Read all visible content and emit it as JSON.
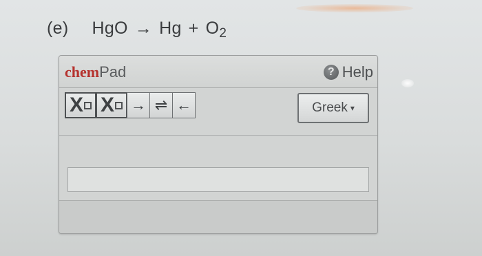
{
  "problem": {
    "label": "(e)",
    "reactant": "HgO",
    "arrow": "→",
    "product1": "Hg",
    "plus": "+",
    "product2_element": "O",
    "product2_subscript": "2"
  },
  "chempad": {
    "brand_chem": "chem",
    "brand_pad": "Pad",
    "help_icon_glyph": "?",
    "help_label": "Help",
    "toolbar": {
      "subscript_label": "X",
      "superscript_label": "X",
      "right_arrow": "→",
      "equilibrium_arrow": "⇌",
      "left_arrow": "←"
    },
    "greek_label": "Greek",
    "greek_caret": "▾",
    "input_value": ""
  },
  "colors": {
    "brand_red": "#b5322e",
    "panel_bg": "#d2d4d3",
    "text_dark": "#3a3c3e"
  }
}
